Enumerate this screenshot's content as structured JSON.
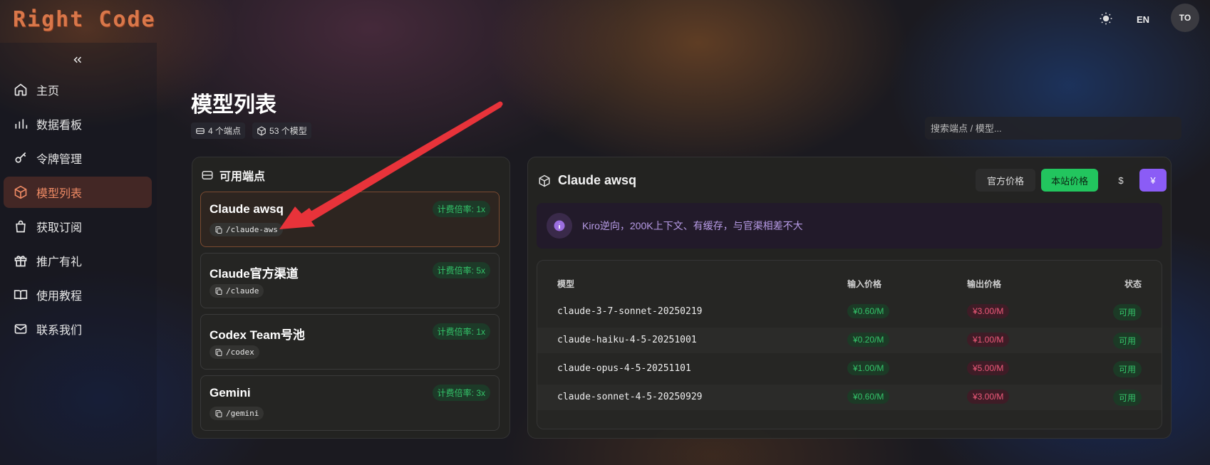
{
  "header": {
    "logo": "Right Code",
    "lang": "EN",
    "avatar": "TO"
  },
  "sidebar": {
    "items": [
      {
        "label": "主页",
        "icon": "home-icon"
      },
      {
        "label": "数据看板",
        "icon": "bar-chart-icon"
      },
      {
        "label": "令牌管理",
        "icon": "key-icon"
      },
      {
        "label": "模型列表",
        "icon": "cube-icon",
        "active": true
      },
      {
        "label": "获取订阅",
        "icon": "shopping-bag-icon"
      },
      {
        "label": "推广有礼",
        "icon": "gift-icon"
      },
      {
        "label": "使用教程",
        "icon": "book-icon"
      },
      {
        "label": "联系我们",
        "icon": "mail-icon"
      }
    ]
  },
  "main": {
    "title": "模型列表",
    "endpoints_count": "4 个端点",
    "models_count": "53 个模型",
    "search_placeholder": "搜索端点 / 模型..."
  },
  "endpoints": {
    "heading": "可用端点",
    "items": [
      {
        "name": "Claude awsq",
        "badge": "计费倍率: 1x",
        "path": "/claude-aws"
      },
      {
        "name": "Claude官方渠道",
        "badge": "计费倍率: 5x",
        "path": "/claude"
      },
      {
        "name": "Codex Team号池",
        "badge": "计费倍率: 1x",
        "path": "/codex"
      },
      {
        "name": "Gemini",
        "badge": "计费倍率: 3x",
        "path": "/gemini"
      }
    ]
  },
  "detail": {
    "title": "Claude awsq",
    "tab_official": "官方价格",
    "tab_site": "本站价格",
    "currency_usd": "$",
    "currency_cny": "¥",
    "notice": "Kiro逆向，200K上下文、有缓存，与官渠相差不大",
    "table": {
      "headers": {
        "model": "模型",
        "input": "输入价格",
        "output": "输出价格",
        "status": "状态"
      },
      "rows": [
        {
          "model": "claude-3-7-sonnet-20250219",
          "input": "¥0.60/M",
          "output": "¥3.00/M",
          "status": "可用"
        },
        {
          "model": "claude-haiku-4-5-20251001",
          "input": "¥0.20/M",
          "output": "¥1.00/M",
          "status": "可用"
        },
        {
          "model": "claude-opus-4-5-20251101",
          "input": "¥1.00/M",
          "output": "¥5.00/M",
          "status": "可用"
        },
        {
          "model": "claude-sonnet-4-5-20250929",
          "input": "¥0.60/M",
          "output": "¥3.00/M",
          "status": "可用"
        }
      ]
    }
  },
  "colors": {
    "accent": "#ee8a64",
    "brand_logo": "#d9774a",
    "green": "#22c55e",
    "purple": "#8b5cf6",
    "red_price": "#ef5a7a",
    "annotation_arrow": "#e8333a"
  }
}
